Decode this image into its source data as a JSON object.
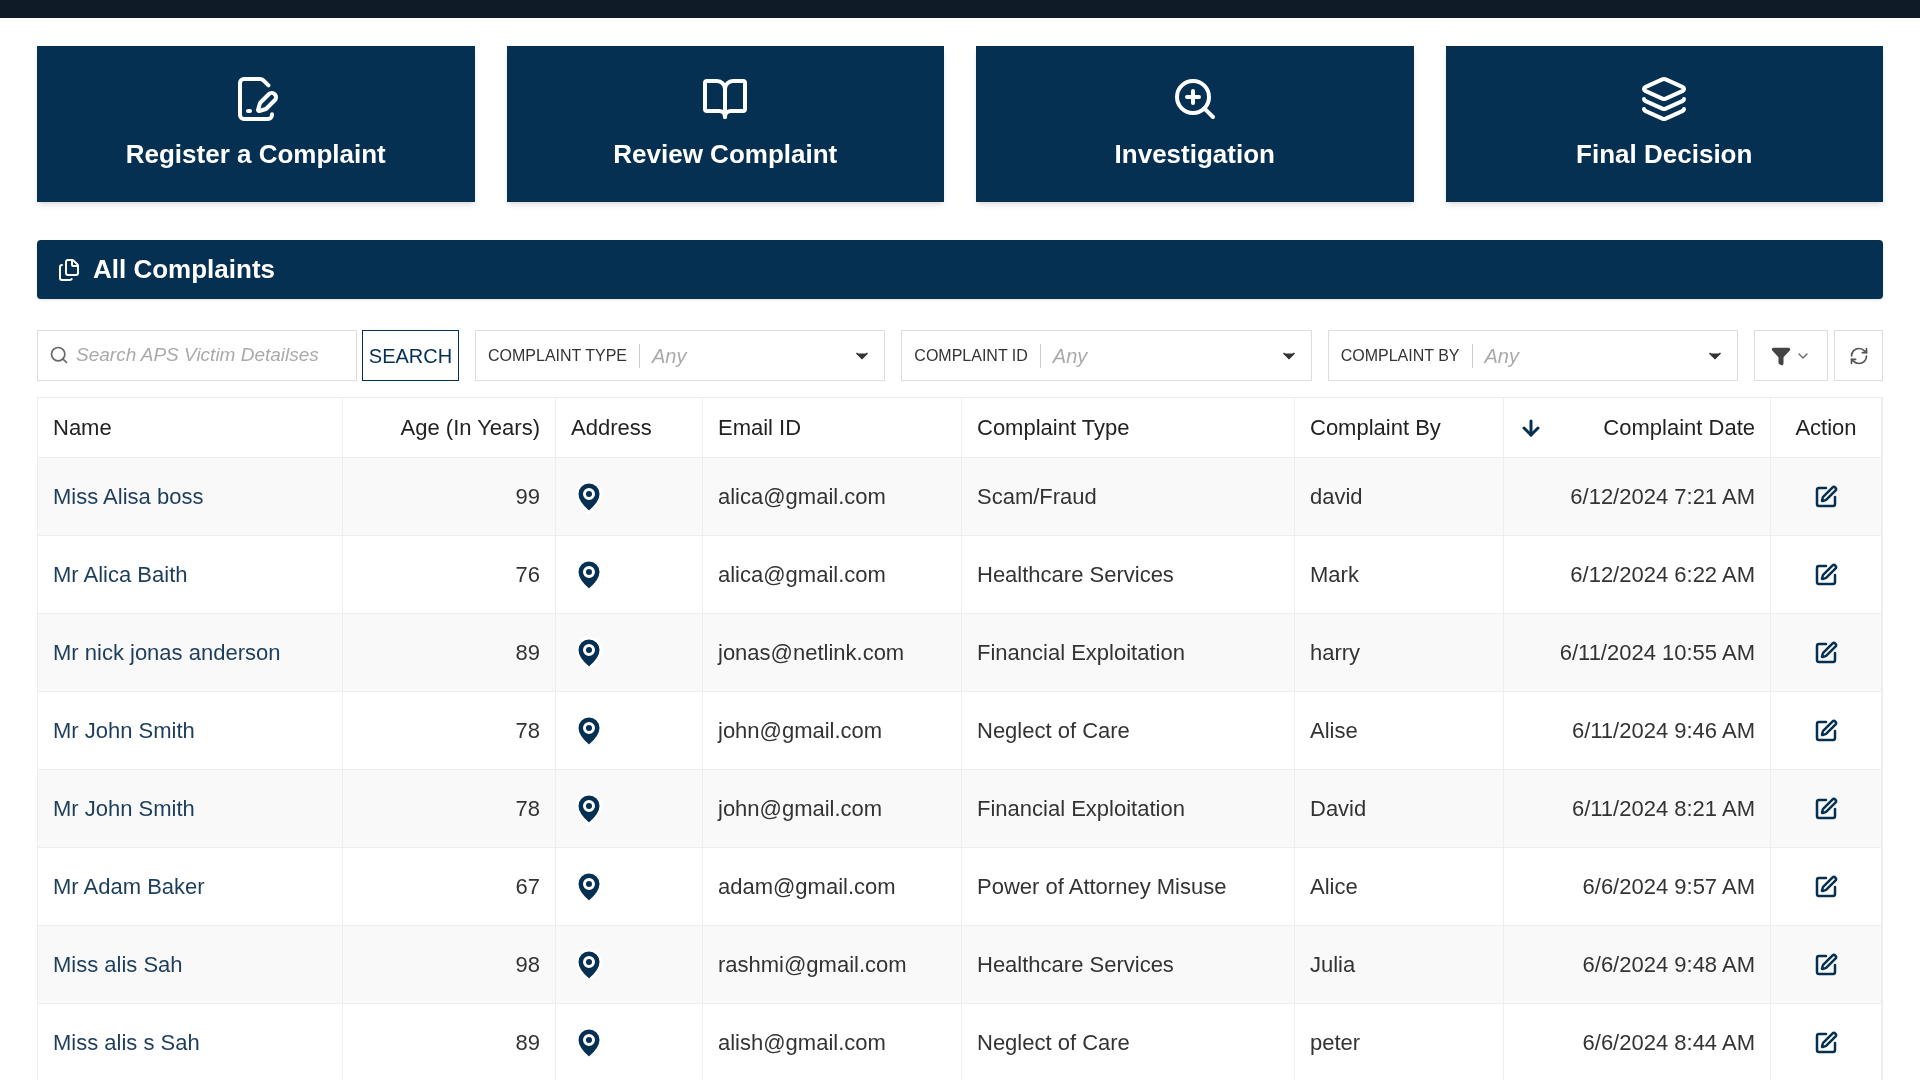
{
  "cards": [
    {
      "kind": "register",
      "label": "Register a Complaint"
    },
    {
      "kind": "review",
      "label": "Review Complaint"
    },
    {
      "kind": "investigation",
      "label": "Investigation"
    },
    {
      "kind": "decision",
      "label": "Final Decision"
    }
  ],
  "panel": {
    "title": "All Complaints"
  },
  "search": {
    "placeholder": "Search APS Victim Detailses",
    "button": "SEARCH"
  },
  "filters": [
    {
      "label": "COMPLAINT TYPE",
      "value": "Any"
    },
    {
      "label": "COMPLAINT ID",
      "value": "Any"
    },
    {
      "label": "COMPLAINT BY",
      "value": "Any"
    }
  ],
  "table": {
    "columns": [
      {
        "label": "Name",
        "sorted": false
      },
      {
        "label": "Age (In Years)",
        "sorted": false
      },
      {
        "label": "Address",
        "sorted": false
      },
      {
        "label": "Email ID",
        "sorted": false
      },
      {
        "label": "Complaint Type",
        "sorted": false
      },
      {
        "label": "Complaint By",
        "sorted": false
      },
      {
        "label": "Complaint Date",
        "sorted": true
      },
      {
        "label": "Action",
        "sorted": false
      }
    ],
    "rows": [
      {
        "name": "Miss Alisa boss",
        "age": "99",
        "email": "alica@gmail.com",
        "type": "Scam/Fraud",
        "by": "david",
        "date": "6/12/2024 7:21 AM"
      },
      {
        "name": "Mr Alica Baith",
        "age": "76",
        "email": "alica@gmail.com",
        "type": "Healthcare Services",
        "by": "Mark",
        "date": "6/12/2024 6:22 AM"
      },
      {
        "name": "Mr nick jonas anderson",
        "age": "89",
        "email": "jonas@netlink.com",
        "type": "Financial Exploitation",
        "by": "harry",
        "date": "6/11/2024 10:55 AM"
      },
      {
        "name": "Mr John Smith",
        "age": "78",
        "email": "john@gmail.com",
        "type": "Neglect of Care",
        "by": "Alise",
        "date": "6/11/2024 9:46 AM"
      },
      {
        "name": "Mr John Smith",
        "age": "78",
        "email": "john@gmail.com",
        "type": "Financial Exploitation",
        "by": "David",
        "date": "6/11/2024 8:21 AM"
      },
      {
        "name": "Mr Adam Baker",
        "age": "67",
        "email": "adam@gmail.com",
        "type": "Power of Attorney Misuse",
        "by": "Alice",
        "date": "6/6/2024 9:57 AM"
      },
      {
        "name": "Miss alis Sah",
        "age": "98",
        "email": "rashmi@gmail.com",
        "type": "Healthcare Services",
        "by": "Julia",
        "date": "6/6/2024 9:48 AM"
      },
      {
        "name": "Miss alis s Sah",
        "age": "89",
        "email": "alish@gmail.com",
        "type": "Neglect of Care",
        "by": "peter",
        "date": "6/6/2024 8:44 AM"
      }
    ]
  }
}
